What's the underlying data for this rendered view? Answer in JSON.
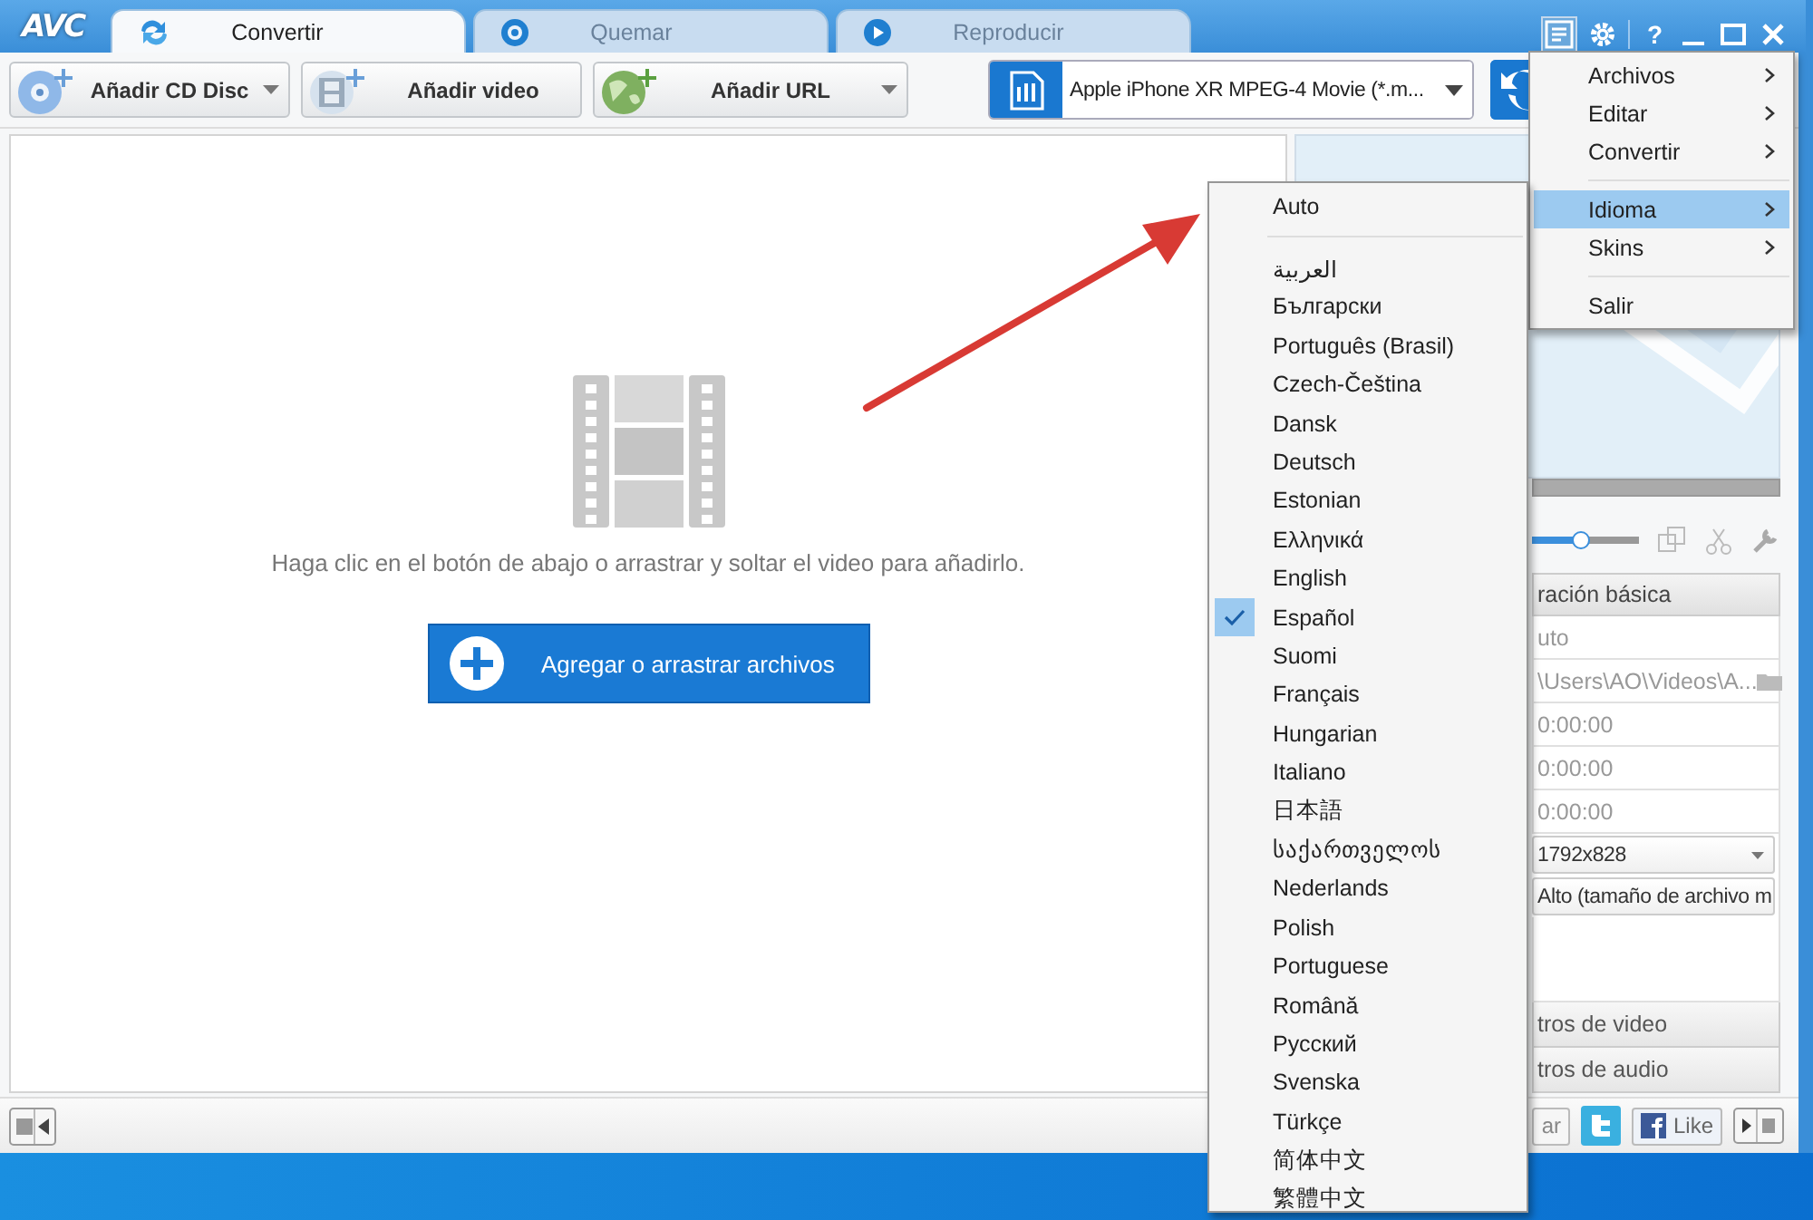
{
  "window": {
    "logo": "AVC",
    "help": "?",
    "tabs": [
      {
        "label": "Convertir",
        "selected": true
      },
      {
        "label": "Quemar",
        "selected": false
      },
      {
        "label": "Reproducir",
        "selected": false
      }
    ]
  },
  "toolbar": {
    "buttons": [
      {
        "label": "Añadir CD Disc",
        "dropdown": true
      },
      {
        "label": "Añadir video",
        "dropdown": false
      },
      {
        "label": "Añadir URL",
        "dropdown": true
      }
    ],
    "profile": {
      "value": "Apple iPhone XR MPEG-4 Movie (*.m..."
    }
  },
  "drop_area": {
    "hint": "Haga clic en el botón de abajo o arrastrar y soltar el video para añadirlo.",
    "button": "Agregar o arrastrar archivos"
  },
  "right_panel": {
    "slider": {
      "level": 0.45
    },
    "section": "ración básica",
    "rows": [
      {
        "kind": "text",
        "value": "uto"
      },
      {
        "kind": "path",
        "value": "\\Users\\AO\\Videos\\A..."
      },
      {
        "kind": "text",
        "value": "0:00:00"
      },
      {
        "kind": "text",
        "value": "0:00:00"
      },
      {
        "kind": "text",
        "value": "0:00:00"
      },
      {
        "kind": "select",
        "value": "1792x828"
      },
      {
        "kind": "select",
        "value": "Alto (tamaño de archivo m"
      }
    ],
    "collapsed": [
      "tros de video",
      "tros de audio"
    ]
  },
  "status_bar": {
    "button": "ar",
    "like": "Like"
  },
  "main_menu": [
    {
      "kind": "item",
      "label": "Archivos",
      "submenu": true,
      "selected": false
    },
    {
      "kind": "item",
      "label": "Editar",
      "submenu": true,
      "selected": false
    },
    {
      "kind": "item",
      "label": "Convertir",
      "submenu": true,
      "selected": false
    },
    {
      "kind": "separator"
    },
    {
      "kind": "item",
      "label": "Idioma",
      "submenu": true,
      "selected": true
    },
    {
      "kind": "item",
      "label": "Skins",
      "submenu": true,
      "selected": false
    },
    {
      "kind": "separator"
    },
    {
      "kind": "item",
      "label": "Salir",
      "submenu": false,
      "selected": false
    }
  ],
  "language_menu": [
    {
      "kind": "item",
      "label": "Auto",
      "checked": false
    },
    {
      "kind": "separator"
    },
    {
      "kind": "item",
      "label": "العربية",
      "checked": false
    },
    {
      "kind": "item",
      "label": "Български",
      "checked": false
    },
    {
      "kind": "item",
      "label": "Português (Brasil)",
      "checked": false
    },
    {
      "kind": "item",
      "label": "Czech-Čeština",
      "checked": false
    },
    {
      "kind": "item",
      "label": "Dansk",
      "checked": false
    },
    {
      "kind": "item",
      "label": "Deutsch",
      "checked": false
    },
    {
      "kind": "item",
      "label": "Estonian",
      "checked": false
    },
    {
      "kind": "item",
      "label": "Ελληνικά",
      "checked": false
    },
    {
      "kind": "item",
      "label": "English",
      "checked": false
    },
    {
      "kind": "item",
      "label": "Español",
      "checked": true
    },
    {
      "kind": "item",
      "label": "Suomi",
      "checked": false
    },
    {
      "kind": "item",
      "label": "Français",
      "checked": false
    },
    {
      "kind": "item",
      "label": "Hungarian",
      "checked": false
    },
    {
      "kind": "item",
      "label": "Italiano",
      "checked": false
    },
    {
      "kind": "item",
      "label": "日本語",
      "checked": false
    },
    {
      "kind": "item",
      "label": "საქართველოს",
      "checked": false
    },
    {
      "kind": "item",
      "label": "Nederlands",
      "checked": false
    },
    {
      "kind": "item",
      "label": "Polish",
      "checked": false
    },
    {
      "kind": "item",
      "label": "Portuguese",
      "checked": false
    },
    {
      "kind": "item",
      "label": "Română",
      "checked": false
    },
    {
      "kind": "item",
      "label": "Русский",
      "checked": false
    },
    {
      "kind": "item",
      "label": "Svenska",
      "checked": false
    },
    {
      "kind": "item",
      "label": "Türkçe",
      "checked": false
    },
    {
      "kind": "item",
      "label": "简体中文",
      "checked": false
    },
    {
      "kind": "item",
      "label": "繁體中文",
      "checked": false
    }
  ]
}
